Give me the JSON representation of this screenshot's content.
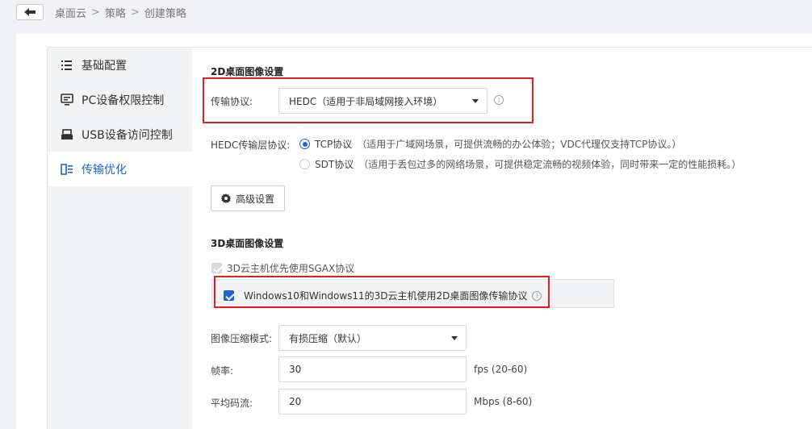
{
  "breadcrumb": [
    "桌面云",
    "策略",
    "创建策略"
  ],
  "sidebar": {
    "items": [
      {
        "label": "基础配置",
        "icon": "list-icon",
        "active": false
      },
      {
        "label": "PC设备权限控制",
        "icon": "monitor-icon",
        "active": false
      },
      {
        "label": "USB设备访问控制",
        "icon": "usb-icon",
        "active": false
      },
      {
        "label": "传输优化",
        "icon": "transfer-icon",
        "active": true
      }
    ]
  },
  "section2d": {
    "title": "2D桌面图像设置",
    "protocol_label": "传输协议:",
    "protocol_value": "HEDC（适用于非局域网接入环境）",
    "layer_label": "HEDC传输层协议:",
    "tcp_label": "TCP协议",
    "tcp_desc": "（适用于广域网场景，可提供流畅的办公体验；VDC代理仅支持TCP协议。）",
    "sdt_label": "SDT协议",
    "sdt_desc": "（适用于丢包过多的网络场景，可提供稳定流畅的视频体验，同时带来一定的性能损耗。）",
    "advanced_label": "高级设置"
  },
  "section3d": {
    "title": "3D桌面图像设置",
    "sgax_label": "3D云主机优先使用SGAX协议",
    "win_label": "Windows10和Windows11的3D云主机使用2D桌面图像传输协议",
    "compression_label": "图像压缩模式:",
    "compression_value": "有损压缩（默认）",
    "fps_label": "帧率:",
    "fps_value": "30",
    "fps_unit": "fps (20-60)",
    "bitrate_label": "平均码流:",
    "bitrate_value": "20",
    "bitrate_unit": "Mbps (8-60)"
  },
  "colors": {
    "accent": "#1f64d1",
    "highlight": "#e02020"
  }
}
